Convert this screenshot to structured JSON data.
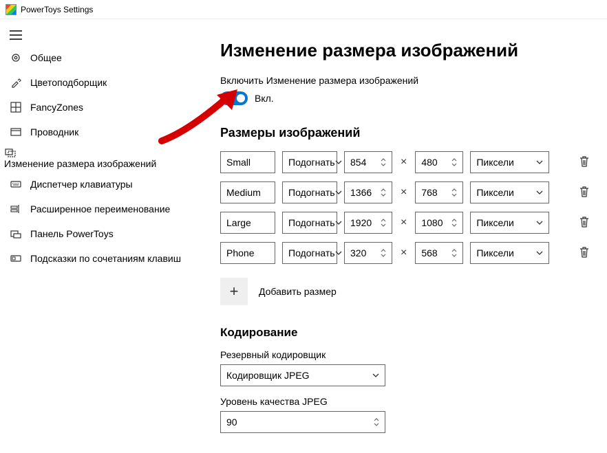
{
  "window": {
    "title": "PowerToys Settings"
  },
  "sidebar": {
    "items": [
      {
        "label": "Общее"
      },
      {
        "label": "Цветоподборщик"
      },
      {
        "label": "FancyZones"
      },
      {
        "label": "Проводник"
      },
      {
        "label": "Изменение размера изображений"
      },
      {
        "label": "Диспетчер клавиатуры"
      },
      {
        "label": "Расширенное переименование"
      },
      {
        "label": "Панель PowerToys"
      },
      {
        "label": "Подсказки по сочетаниям клавиш"
      }
    ]
  },
  "main": {
    "heading": "Изменение размера изображений",
    "enable_label": "Включить Изменение размера изображений",
    "toggle_state": "Вкл.",
    "sizes_heading": "Размеры изображений",
    "fit_label": "Подогнать",
    "unit_label": "Пиксели",
    "sizes": [
      {
        "name": "Small",
        "w": "854",
        "h": "480"
      },
      {
        "name": "Medium",
        "w": "1366",
        "h": "768"
      },
      {
        "name": "Large",
        "w": "1920",
        "h": "1080"
      },
      {
        "name": "Phone",
        "w": "320",
        "h": "568"
      }
    ],
    "add_size_label": "Добавить размер",
    "encoding_heading": "Кодирование",
    "fallback_encoder_label": "Резервный кодировщик",
    "fallback_encoder_value": "Кодировщик JPEG",
    "jpeg_quality_label": "Уровень качества JPEG",
    "jpeg_quality_value": "90"
  }
}
